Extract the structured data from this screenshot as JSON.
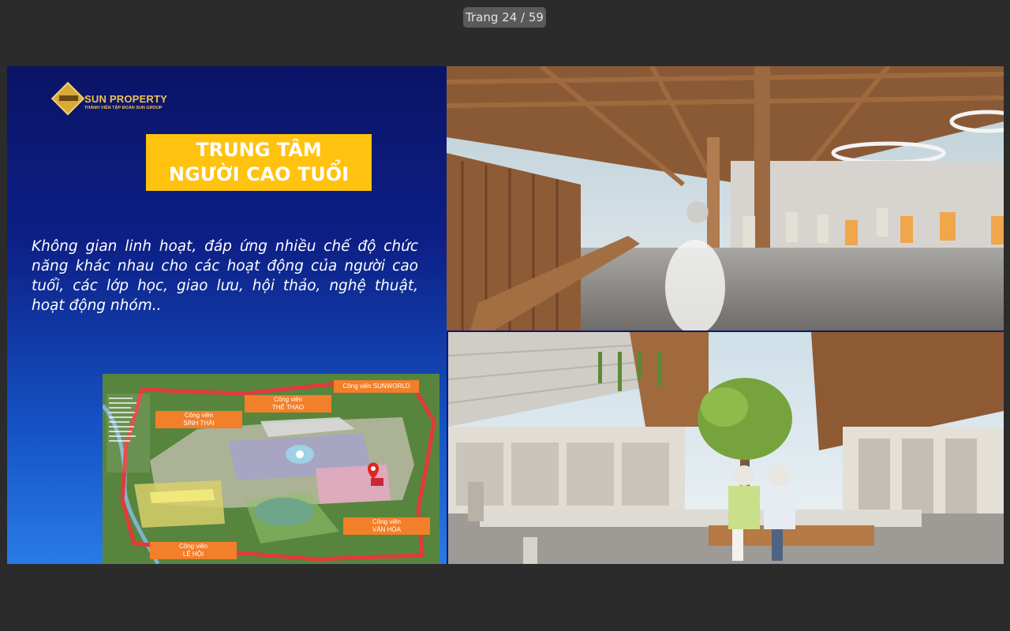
{
  "viewer": {
    "page_indicator": "Trang 24 / 59",
    "background": "#2b2b2b"
  },
  "slide": {
    "logo": {
      "name": "SUN PROPERTY",
      "tagline": "THÀNH VIÊN TẬP ĐOÀN SUN GROUP",
      "icon": "sun-group-diamond-logo"
    },
    "title_line1": "TRUNG TÂM",
    "title_line2": "NGƯỜI CAO TUỔI",
    "description": "Không gian linh hoạt, đáp ứng nhiều chế độ chức năng khác nhau cho các hoạt động của người cao tuổi, các lớp học, giao lưu, hội thảo, nghệ thuật, hoạt động nhóm..",
    "colors": {
      "title_bg": "#ffc20e",
      "panel_top": "#0a1466",
      "panel_bottom": "#2a7be6",
      "map_label": "#f27f2a"
    },
    "map": {
      "labels": {
        "sunworld": "Công viên SUNWORLD",
        "the_thao": "Công viên\nTHỂ THAO",
        "sinh_thai": "Công viên\nSINH THÁI",
        "van_hoa": "Công viên\nVĂN HÓA",
        "le_hoi": "Công viên\nLỄ HỘI"
      }
    },
    "photos": {
      "top": "exercise-hall-rendering",
      "bottom": "courtyard-rendering"
    }
  }
}
